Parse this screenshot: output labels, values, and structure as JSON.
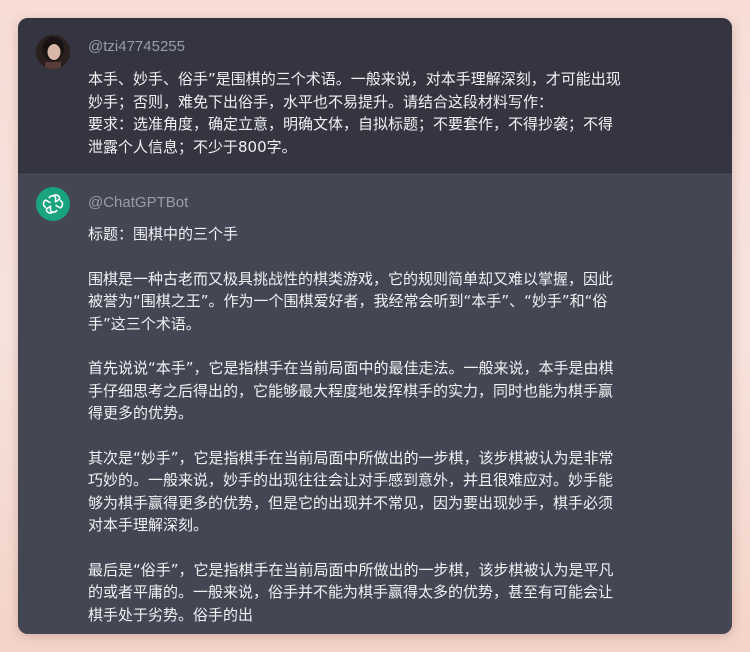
{
  "user_message": {
    "handle": "@tzi47745255",
    "lines": [
      "本手、妙手、俗手”是围棋的三个术语。一般来说，对本手理解深刻，才可能出现",
      "妙手；否则，难免下出俗手，水平也不易提升。请结合这段材料写作：",
      "要求：选准角度，确定立意，明确文体，自拟标题；不要套作，不得抄袭；不得",
      "泄露个人信息；不少于800字。"
    ]
  },
  "bot_message": {
    "handle": "@ChatGPTBot",
    "paragraphs": [
      [
        "标题：围棋中的三个手"
      ],
      [
        "围棋是一种古老而又极具挑战性的棋类游戏，它的规则简单却又难以掌握，因此",
        "被誉为“围棋之王”。作为一个围棋爱好者，我经常会听到“本手”、“妙手”和“俗",
        "手”这三个术语。"
      ],
      [
        "首先说说“本手”，它是指棋手在当前局面中的最佳走法。一般来说，本手是由棋",
        "手仔细思考之后得出的，它能够最大程度地发挥棋手的实力，同时也能为棋手赢",
        "得更多的优势。"
      ],
      [
        "其次是“妙手”，它是指棋手在当前局面中所做出的一步棋，该步棋被认为是非常",
        "巧妙的。一般来说，妙手的出现往往会让对手感到意外，并且很难应对。妙手能",
        "够为棋手赢得更多的优势，但是它的出现并不常见，因为要出现妙手，棋手必须",
        "对本手理解深刻。"
      ],
      [
        "最后是“俗手”，它是指棋手在当前局面中所做出的一步棋，该步棋被认为是平凡",
        "的或者平庸的。一般来说，俗手并不能为棋手赢得太多的优势，甚至有可能会让",
        "棋手处于劣势。俗手的出"
      ]
    ]
  }
}
